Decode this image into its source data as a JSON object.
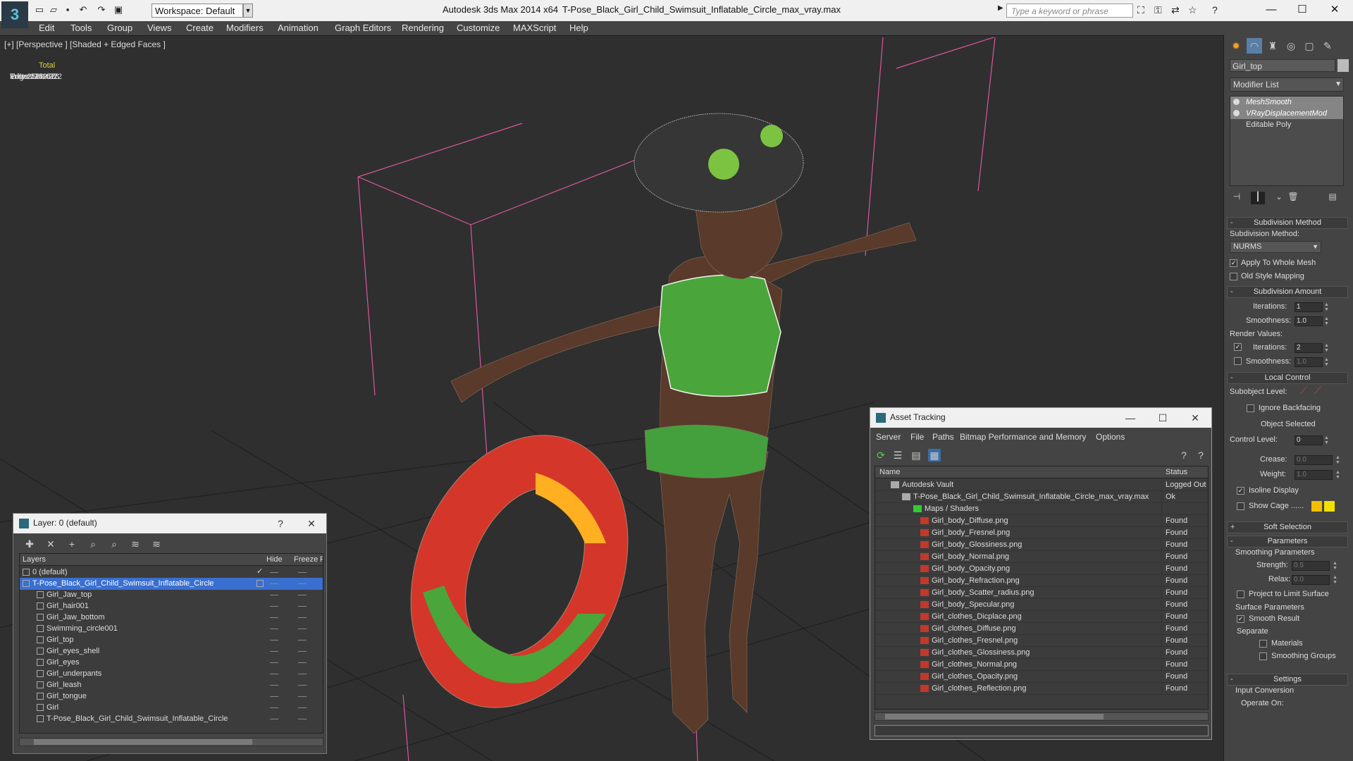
{
  "app": {
    "title": "Autodesk 3ds Max  2014 x64",
    "file": "T-Pose_Black_Girl_Child_Swimsuit_Inflatable_Circle_max_vray.max",
    "workspace": "Workspace: Default",
    "search_placeholder": "Type a keyword or phrase"
  },
  "menu": [
    "Edit",
    "Tools",
    "Group",
    "Views",
    "Create",
    "Modifiers",
    "Animation",
    "Graph Editors",
    "Rendering",
    "Customize",
    "MAXScript",
    "Help"
  ],
  "viewport": {
    "label": "[+] [Perspective ] [Shaded + Edged Faces ]",
    "stats": {
      "total_label": "Total",
      "rows": [
        {
          "k": "Polys:",
          "v": "129 076"
        },
        {
          "k": "Tris:",
          "v": "258 152"
        },
        {
          "k": "Edges:",
          "v": "302 372"
        },
        {
          "k": "Verts:",
          "v": "174 422"
        }
      ]
    }
  },
  "cmd": {
    "object_name": "Girl_top",
    "modifier_list": "Modifier List",
    "stack": [
      {
        "label": "MeshSmooth",
        "sel": true
      },
      {
        "label": "VRayDisplacementMod",
        "sel": true
      },
      {
        "label": "Editable Poly",
        "sel": false
      }
    ],
    "subdivision_method": {
      "title": "Subdivision Method",
      "method_label": "Subdivision Method:",
      "method": "NURMS",
      "apply_whole": "Apply To Whole Mesh",
      "old_style": "Old Style Mapping"
    },
    "subdivision_amount": {
      "title": "Subdivision Amount",
      "iterations_label": "Iterations:",
      "iterations": "1",
      "smoothness_label": "Smoothness:",
      "smoothness": "1.0",
      "render_values": "Render Values:",
      "r_iterations": "2",
      "r_smoothness": "1.0"
    },
    "local_control": {
      "title": "Local Control",
      "subobject_level": "Subobject Level:",
      "ignore_backfacing": "Ignore Backfacing",
      "object_selected": "Object Selected",
      "control_level": "Control Level:",
      "control_level_val": "0",
      "crease": "Crease:",
      "crease_val": "0.0",
      "weight": "Weight:",
      "weight_val": "1.0",
      "isoline": "Isoline Display",
      "show_cage": "Show Cage ......"
    },
    "soft_selection": {
      "title": "Soft Selection"
    },
    "parameters": {
      "title": "Parameters",
      "smoothing": "Smoothing Parameters",
      "strength": "Strength:",
      "strength_val": "0.5",
      "relax": "Relax:",
      "relax_val": "0.0",
      "project": "Project to Limit Surface",
      "surface": "Surface Parameters",
      "smooth_result": "Smooth Result",
      "separate": "Separate",
      "materials": "Materials",
      "smoothing_groups": "Smoothing Groups"
    },
    "settings": {
      "title": "Settings",
      "input_conversion": "Input Conversion",
      "operate_on": "Operate On:"
    }
  },
  "layer": {
    "title": "Layer: 0 (default)",
    "help": "?",
    "cols": {
      "layers": "Layers",
      "hide": "Hide",
      "freeze": "Freeze",
      "r": "R"
    },
    "rows": [
      {
        "name": "0 (default)",
        "lvl": 0
      },
      {
        "name": "T-Pose_Black_Girl_Child_Swimsuit_Inflatable_Circle",
        "lvl": 0,
        "hi": true
      },
      {
        "name": "Girl_Jaw_top",
        "lvl": 1
      },
      {
        "name": "Girl_hair001",
        "lvl": 1
      },
      {
        "name": "Girl_Jaw_bottom",
        "lvl": 1
      },
      {
        "name": "Swimming_circle001",
        "lvl": 1
      },
      {
        "name": "Girl_top",
        "lvl": 1
      },
      {
        "name": "Girl_eyes_shell",
        "lvl": 1
      },
      {
        "name": "Girl_eyes",
        "lvl": 1
      },
      {
        "name": "Girl_underpants",
        "lvl": 1
      },
      {
        "name": "Girl_leash",
        "lvl": 1
      },
      {
        "name": "Girl_tongue",
        "lvl": 1
      },
      {
        "name": "Girl",
        "lvl": 1
      },
      {
        "name": "T-Pose_Black_Girl_Child_Swimsuit_Inflatable_Circle",
        "lvl": 1
      }
    ]
  },
  "asset": {
    "title": "Asset Tracking",
    "menu": [
      "Server",
      "File",
      "Paths",
      "Bitmap Performance and Memory",
      "Options"
    ],
    "cols": {
      "name": "Name",
      "status": "Status"
    },
    "rows": [
      {
        "name": "Autodesk Vault",
        "status": "Logged Out",
        "lvl": 0
      },
      {
        "name": "T-Pose_Black_Girl_Child_Swimsuit_Inflatable_Circle_max_vray.max",
        "status": "Ok",
        "lvl": 1
      },
      {
        "name": "Maps / Shaders",
        "status": "",
        "lvl": 2
      },
      {
        "name": "Girl_body_Diffuse.png",
        "status": "Found",
        "lvl": 3
      },
      {
        "name": "Girl_body_Fresnel.png",
        "status": "Found",
        "lvl": 3
      },
      {
        "name": "Girl_body_Glossiness.png",
        "status": "Found",
        "lvl": 3
      },
      {
        "name": "Girl_body_Normal.png",
        "status": "Found",
        "lvl": 3
      },
      {
        "name": "Girl_body_Opacity.png",
        "status": "Found",
        "lvl": 3
      },
      {
        "name": "Girl_body_Refraction.png",
        "status": "Found",
        "lvl": 3
      },
      {
        "name": "Girl_body_Scatter_radius.png",
        "status": "Found",
        "lvl": 3
      },
      {
        "name": "Girl_body_Specular.png",
        "status": "Found",
        "lvl": 3
      },
      {
        "name": "Girl_clothes_Dicplace.png",
        "status": "Found",
        "lvl": 3
      },
      {
        "name": "Girl_clothes_Diffuse.png",
        "status": "Found",
        "lvl": 3
      },
      {
        "name": "Girl_clothes_Fresnel.png",
        "status": "Found",
        "lvl": 3
      },
      {
        "name": "Girl_clothes_Glossiness.png",
        "status": "Found",
        "lvl": 3
      },
      {
        "name": "Girl_clothes_Normal.png",
        "status": "Found",
        "lvl": 3
      },
      {
        "name": "Girl_clothes_Opacity.png",
        "status": "Found",
        "lvl": 3
      },
      {
        "name": "Girl_clothes_Reflection.png",
        "status": "Found",
        "lvl": 3
      }
    ]
  },
  "icons": {
    "file": "png-file-icon",
    "layer": "object-icon"
  }
}
